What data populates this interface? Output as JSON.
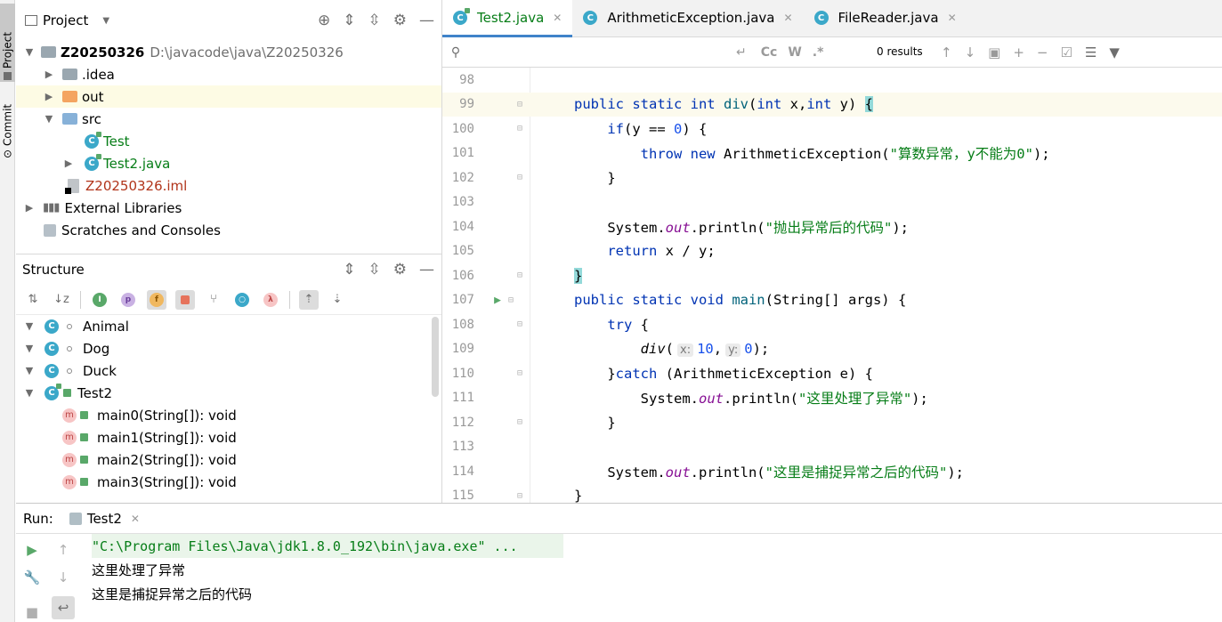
{
  "sidebar_left": {
    "project_tab": "Project",
    "commit_tab": "Commit"
  },
  "project_panel": {
    "title": "Project",
    "root": {
      "name": "Z20250326",
      "path": "D:\\javacode\\java\\Z20250326"
    },
    "items": [
      {
        "label": ".idea"
      },
      {
        "label": "out"
      },
      {
        "label": "src"
      },
      {
        "label": "Test"
      },
      {
        "label": "Test2.java"
      },
      {
        "label": "Z20250326.iml"
      },
      {
        "label": "External Libraries"
      },
      {
        "label": "Scratches and Consoles"
      }
    ]
  },
  "structure_panel": {
    "title": "Structure",
    "toolbar_icons": [
      "sort-visibility-icon",
      "sort-alpha-icon",
      "inherited-icon",
      "properties-icon",
      "fields-icon",
      "non-public-icon",
      "lambdas-icon",
      "anonymous-icon",
      "lambda-icon",
      "autoscroll-to-source-icon",
      "autoscroll-from-source-icon"
    ],
    "items": [
      {
        "label": "Animal"
      },
      {
        "label": "Dog"
      },
      {
        "label": "Duck"
      },
      {
        "label": "Test2"
      },
      {
        "label": "main0(String[]): void"
      },
      {
        "label": "main1(String[]): void"
      },
      {
        "label": "main2(String[]): void"
      },
      {
        "label": "main3(String[]): void"
      }
    ]
  },
  "editor": {
    "tabs": [
      {
        "label": "Test2.java",
        "active": true
      },
      {
        "label": "ArithmeticException.java",
        "active": false
      },
      {
        "label": "FileReader.java",
        "active": false
      }
    ],
    "search": {
      "value": "",
      "results": "0 results",
      "opt_case": "Cc",
      "opt_words": "W",
      "opt_regex": ".*"
    },
    "lines": [
      {
        "n": "98"
      },
      {
        "n": "99"
      },
      {
        "n": "100"
      },
      {
        "n": "101"
      },
      {
        "n": "102"
      },
      {
        "n": "103"
      },
      {
        "n": "104"
      },
      {
        "n": "105"
      },
      {
        "n": "106"
      },
      {
        "n": "107"
      },
      {
        "n": "108"
      },
      {
        "n": "109"
      },
      {
        "n": "110"
      },
      {
        "n": "111"
      },
      {
        "n": "112"
      },
      {
        "n": "113"
      },
      {
        "n": "114"
      },
      {
        "n": "115"
      }
    ],
    "code": {
      "l99_mod": "public static int ",
      "l99_fn": "div",
      "l99_params": "(",
      "l99_int1": "int",
      "l99_x": " x,",
      "l99_int2": "int",
      "l99_y": " y) ",
      "l99_brace": "{",
      "l100_if": "if",
      "l100_cond": "(y == ",
      "l100_zero": "0",
      "l100_end": ") {",
      "l101_throw": "throw new ",
      "l101_cls": "ArithmeticException(",
      "l101_str": "\"算数异常，y不能为0\"",
      "l101_end": ");",
      "l102": "}",
      "l104_sys": "System.",
      "l104_out": "out",
      "l104_println": ".println(",
      "l104_str": "\"抛出异常后的代码\"",
      "l104_end": ");",
      "l105_ret": "return",
      "l105_rest": " x / y;",
      "l106": "}",
      "l107_mod": "public static void ",
      "l107_fn": "main",
      "l107_rest": "(String[] args) {",
      "l108_try": "try",
      "l108_rest": " {",
      "l109_fn": "div",
      "l109_open": "(",
      "l109_hint_x": "x:",
      "l109_v1": "10",
      "l109_comma": ",",
      "l109_hint_y": "y:",
      "l109_v2": "0",
      "l109_end": ");",
      "l110_open": "}",
      "l110_catch": "catch",
      "l110_rest": " (ArithmeticException e) {",
      "l111_sys": "System.",
      "l111_out": "out",
      "l111_println": ".println(",
      "l111_str": "\"这里处理了异常\"",
      "l111_end": ");",
      "l112": "}",
      "l114_sys": "System.",
      "l114_out": "out",
      "l114_println": ".println(",
      "l114_str": "\"这里是捕捉异常之后的代码\"",
      "l114_end": ");",
      "l115": "}"
    }
  },
  "run_panel": {
    "label": "Run:",
    "tab": "Test2",
    "output": [
      "\"C:\\Program Files\\Java\\jdk1.8.0_192\\bin\\java.exe\" ...",
      "这里处理了异常",
      "这里是捕捉异常之后的代码"
    ]
  },
  "colors": {
    "keyword": "#0033b3",
    "string": "#067d17",
    "number": "#1750eb",
    "field": "#871094",
    "tab_accent": "#4083c9"
  }
}
